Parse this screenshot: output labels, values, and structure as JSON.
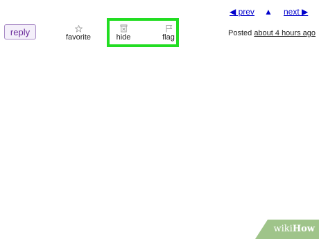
{
  "nav": {
    "prev_label": "◀ prev",
    "up_label": "▲",
    "next_label": "next ▶"
  },
  "actions": {
    "reply_label": "reply",
    "favorite_label": "favorite",
    "hide_label": "hide",
    "flag_label": "flag"
  },
  "posted": {
    "prefix": "Posted",
    "time": "about 4 hours ago"
  },
  "watermark": {
    "part1": "wiki",
    "part2": "How"
  },
  "colors": {
    "highlight": "#22dd22",
    "link": "#0000cc",
    "reply_text": "#6a2a9a",
    "watermark_bg": "#9fc48a"
  },
  "icons": {
    "favorite": "star-icon",
    "hide": "trash-icon",
    "flag": "flag-icon"
  }
}
